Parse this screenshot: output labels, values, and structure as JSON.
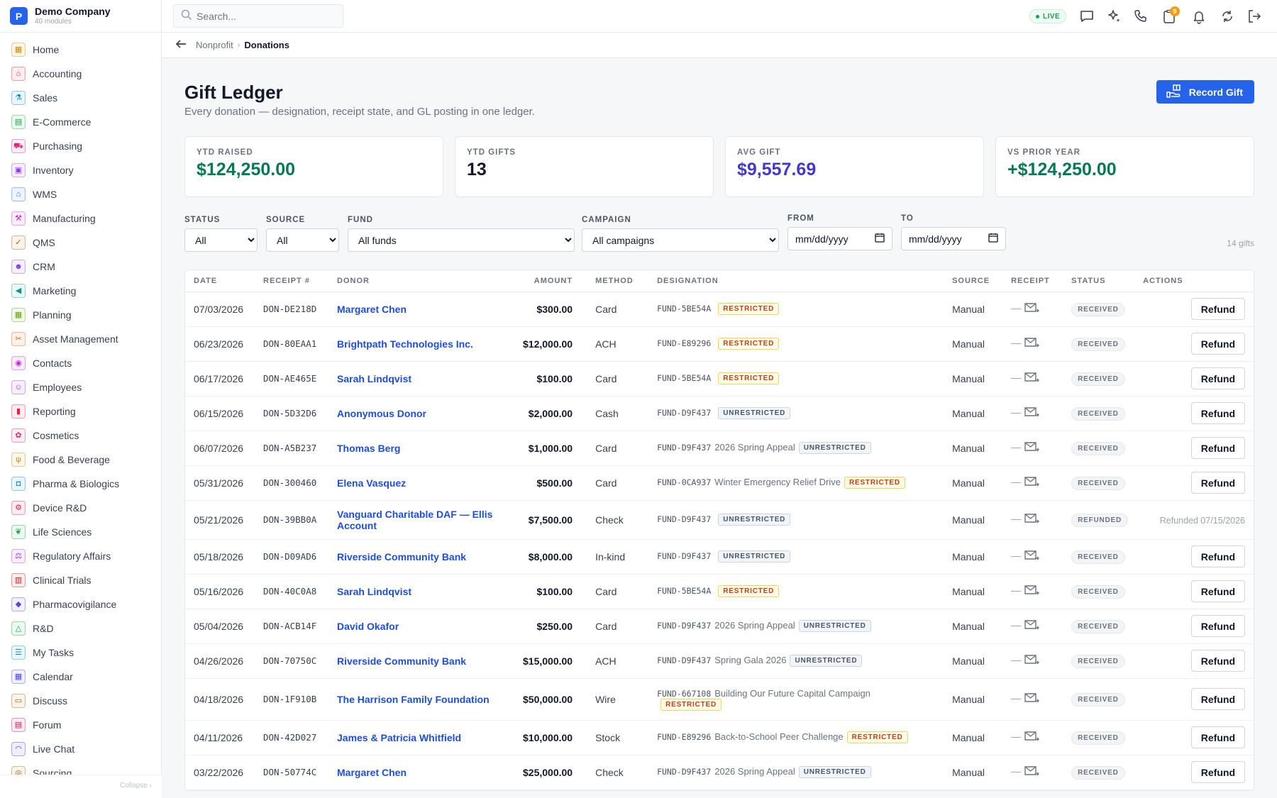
{
  "brand": {
    "logo_letter": "P",
    "name": "Demo Company",
    "sub": "40 modules"
  },
  "sidebar": {
    "items": [
      {
        "label": "Home",
        "icon": "grid-icon",
        "color": "#ca8a04"
      },
      {
        "label": "Accounting",
        "icon": "bank-icon",
        "color": "#dc2626"
      },
      {
        "label": "Sales",
        "icon": "flask-icon",
        "color": "#0284c7"
      },
      {
        "label": "E-Commerce",
        "icon": "store-icon",
        "color": "#16a34a"
      },
      {
        "label": "Purchasing",
        "icon": "cart-icon",
        "color": "#db2777"
      },
      {
        "label": "Inventory",
        "icon": "box-icon",
        "color": "#9333ea"
      },
      {
        "label": "WMS",
        "icon": "warehouse-icon",
        "color": "#2563eb"
      },
      {
        "label": "Manufacturing",
        "icon": "factory-icon",
        "color": "#c026d3"
      },
      {
        "label": "QMS",
        "icon": "check-circle-icon",
        "color": "#a16207"
      },
      {
        "label": "CRM",
        "icon": "people-icon",
        "color": "#7c3aed"
      },
      {
        "label": "Marketing",
        "icon": "megaphone-icon",
        "color": "#0d9488"
      },
      {
        "label": "Planning",
        "icon": "calendar-grid-icon",
        "color": "#65a30d"
      },
      {
        "label": "Asset Management",
        "icon": "tools-icon",
        "color": "#ea580c"
      },
      {
        "label": "Contacts",
        "icon": "contact-icon",
        "color": "#c026d3"
      },
      {
        "label": "Employees",
        "icon": "employees-icon",
        "color": "#9333ea"
      },
      {
        "label": "Reporting",
        "icon": "bar-chart-icon",
        "color": "#e11d48"
      },
      {
        "label": "Cosmetics",
        "icon": "lotus-icon",
        "color": "#db2777"
      },
      {
        "label": "Food & Beverage",
        "icon": "fork-knife-icon",
        "color": "#ca8a04"
      },
      {
        "label": "Pharma & Biologics",
        "icon": "pill-icon",
        "color": "#0284c7"
      },
      {
        "label": "Device R&D",
        "icon": "gear-icon",
        "color": "#e11d48"
      },
      {
        "label": "Life Sciences",
        "icon": "leaf-icon",
        "color": "#16a34a"
      },
      {
        "label": "Regulatory Affairs",
        "icon": "gavel-icon",
        "color": "#9333ea"
      },
      {
        "label": "Clinical Trials",
        "icon": "clipboard-icon",
        "color": "#b91c1c"
      },
      {
        "label": "Pharmacovigilance",
        "icon": "shield-icon",
        "color": "#4f46e5"
      },
      {
        "label": "R&D",
        "icon": "beaker-icon",
        "color": "#16a34a"
      },
      {
        "label": "My Tasks",
        "icon": "tasks-icon",
        "color": "#0891b2"
      },
      {
        "label": "Calendar",
        "icon": "calendar-icon",
        "color": "#4f46e5"
      },
      {
        "label": "Discuss",
        "icon": "chat-icon",
        "color": "#a16207"
      },
      {
        "label": "Forum",
        "icon": "forum-icon",
        "color": "#be185d"
      },
      {
        "label": "Live Chat",
        "icon": "headset-icon",
        "color": "#4338ca"
      },
      {
        "label": "Sourcing",
        "icon": "sourcing-icon",
        "color": "#a16207"
      }
    ],
    "collapse_label": "Collapse ‹"
  },
  "topbar": {
    "search_placeholder": "Search...",
    "live_label": "LIVE",
    "notifications_badge": "9",
    "colors": {
      "live": "#16a34a",
      "badge": "#f59e0b"
    }
  },
  "breadcrumb": {
    "parent": "Nonprofit",
    "current": "Donations"
  },
  "page": {
    "title": "Gift Ledger",
    "subtitle": "Every donation — designation, receipt state, and GL posting in one ledger.",
    "record_button": "Record Gift",
    "accent": "#2563eb"
  },
  "kpis": [
    {
      "label": "YTD RAISED",
      "value": "$124,250.00",
      "color": "#047857"
    },
    {
      "label": "YTD GIFTS",
      "value": "13",
      "color": "#111827"
    },
    {
      "label": "AVG GIFT",
      "value": "$9,557.69",
      "color": "#4338ca"
    },
    {
      "label": "VS PRIOR YEAR",
      "value": "+$124,250.00",
      "color": "#047857"
    }
  ],
  "filters": {
    "status": {
      "label": "STATUS",
      "value": "All"
    },
    "source": {
      "label": "SOURCE",
      "value": "All"
    },
    "fund": {
      "label": "FUND",
      "value": "All funds"
    },
    "campaign": {
      "label": "CAMPAIGN",
      "value": "All campaigns"
    },
    "from": {
      "label": "FROM",
      "value": "mm/dd/yyyy"
    },
    "to": {
      "label": "TO",
      "value": "mm/dd/yyyy"
    },
    "count": "14 gifts"
  },
  "table": {
    "columns": [
      "DATE",
      "RECEIPT #",
      "DONOR",
      "AMOUNT",
      "METHOD",
      "DESIGNATION",
      "SOURCE",
      "RECEIPT",
      "STATUS",
      "ACTIONS"
    ],
    "refund_label": "Refund",
    "receipt_dash": "—",
    "rows": [
      {
        "date": "07/03/2026",
        "receipt": "DON-DE218D",
        "donor": "Margaret Chen",
        "amount": "$300.00",
        "method": "Card",
        "fund": "FUND-5BE54A",
        "campaign": "",
        "tag": "RESTRICTED",
        "source": "Manual",
        "status": "RECEIVED",
        "action": "Refund"
      },
      {
        "date": "06/23/2026",
        "receipt": "DON-80EAA1",
        "donor": "Brightpath Technologies Inc.",
        "amount": "$12,000.00",
        "method": "ACH",
        "fund": "FUND-E89296",
        "campaign": "",
        "tag": "RESTRICTED",
        "source": "Manual",
        "status": "RECEIVED",
        "action": "Refund"
      },
      {
        "date": "06/17/2026",
        "receipt": "DON-AE465E",
        "donor": "Sarah Lindqvist",
        "amount": "$100.00",
        "method": "Card",
        "fund": "FUND-5BE54A",
        "campaign": "",
        "tag": "RESTRICTED",
        "source": "Manual",
        "status": "RECEIVED",
        "action": "Refund"
      },
      {
        "date": "06/15/2026",
        "receipt": "DON-5D32D6",
        "donor": "Anonymous Donor",
        "amount": "$2,000.00",
        "method": "Cash",
        "fund": "FUND-D9F437",
        "campaign": "",
        "tag": "UNRESTRICTED",
        "source": "Manual",
        "status": "RECEIVED",
        "action": "Refund"
      },
      {
        "date": "06/07/2026",
        "receipt": "DON-A5B237",
        "donor": "Thomas Berg",
        "amount": "$1,000.00",
        "method": "Card",
        "fund": "FUND-D9F437",
        "campaign": "2026 Spring Appeal",
        "tag": "UNRESTRICTED",
        "source": "Manual",
        "status": "RECEIVED",
        "action": "Refund"
      },
      {
        "date": "05/31/2026",
        "receipt": "DON-300460",
        "donor": "Elena Vasquez",
        "amount": "$500.00",
        "method": "Card",
        "fund": "FUND-0CA937",
        "campaign": "Winter Emergency Relief Drive",
        "tag": "RESTRICTED",
        "source": "Manual",
        "status": "RECEIVED",
        "action": "Refund"
      },
      {
        "date": "05/21/2026",
        "receipt": "DON-39BB0A",
        "donor": "Vanguard Charitable DAF — Ellis Account",
        "amount": "$7,500.00",
        "method": "Check",
        "fund": "FUND-D9F437",
        "campaign": "",
        "tag": "UNRESTRICTED",
        "source": "Manual",
        "status": "REFUNDED",
        "action": "Refunded 07/15/2026"
      },
      {
        "date": "05/18/2026",
        "receipt": "DON-D09AD6",
        "donor": "Riverside Community Bank",
        "amount": "$8,000.00",
        "method": "In-kind",
        "fund": "FUND-D9F437",
        "campaign": "",
        "tag": "UNRESTRICTED",
        "source": "Manual",
        "status": "RECEIVED",
        "action": "Refund"
      },
      {
        "date": "05/16/2026",
        "receipt": "DON-40C0A8",
        "donor": "Sarah Lindqvist",
        "amount": "$100.00",
        "method": "Card",
        "fund": "FUND-5BE54A",
        "campaign": "",
        "tag": "RESTRICTED",
        "source": "Manual",
        "status": "RECEIVED",
        "action": "Refund"
      },
      {
        "date": "05/04/2026",
        "receipt": "DON-ACB14F",
        "donor": "David Okafor",
        "amount": "$250.00",
        "method": "Card",
        "fund": "FUND-D9F437",
        "campaign": "2026 Spring Appeal",
        "tag": "UNRESTRICTED",
        "source": "Manual",
        "status": "RECEIVED",
        "action": "Refund"
      },
      {
        "date": "04/26/2026",
        "receipt": "DON-70750C",
        "donor": "Riverside Community Bank",
        "amount": "$15,000.00",
        "method": "ACH",
        "fund": "FUND-D9F437",
        "campaign": "Spring Gala 2026",
        "tag": "UNRESTRICTED",
        "source": "Manual",
        "status": "RECEIVED",
        "action": "Refund"
      },
      {
        "date": "04/18/2026",
        "receipt": "DON-1F910B",
        "donor": "The Harrison Family Foundation",
        "amount": "$50,000.00",
        "method": "Wire",
        "fund": "FUND-667108",
        "campaign": "Building Our Future Capital Campaign",
        "tag": "RESTRICTED",
        "source": "Manual",
        "status": "RECEIVED",
        "action": "Refund"
      },
      {
        "date": "04/11/2026",
        "receipt": "DON-42D027",
        "donor": "James & Patricia Whitfield",
        "amount": "$10,000.00",
        "method": "Stock",
        "fund": "FUND-E89296",
        "campaign": "Back-to-School Peer Challenge",
        "tag": "RESTRICTED",
        "source": "Manual",
        "status": "RECEIVED",
        "action": "Refund"
      },
      {
        "date": "03/22/2026",
        "receipt": "DON-50774C",
        "donor": "Margaret Chen",
        "amount": "$25,000.00",
        "method": "Check",
        "fund": "FUND-D9F437",
        "campaign": "2026 Spring Appeal",
        "tag": "UNRESTRICTED",
        "source": "Manual",
        "status": "RECEIVED",
        "action": "Refund"
      }
    ]
  }
}
